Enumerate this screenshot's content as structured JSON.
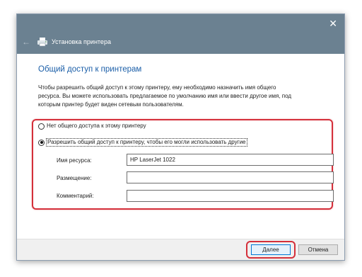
{
  "window": {
    "title": "Установка принтера",
    "close_glyph": "✕",
    "back_glyph": "←"
  },
  "page": {
    "heading": "Общий доступ к принтерам",
    "description": "Чтобы разрешить общий доступ к этому принтеру, ему необходимо назначить имя общего\nресурса. Вы можете использовать предлагаемое по умолчанию имя или ввести другое имя, под\nкоторым принтер будет виден сетевым пользователям."
  },
  "options": {
    "no_share_label": "Нет общего доступа к этому принтеру",
    "share_label": "Разрешить общий доступ к принтеру, чтобы его могли использовать другие",
    "selected": "share"
  },
  "fields": {
    "share_name_label": "Имя ресурса:",
    "share_name_value": "HP LaserJet 1022",
    "location_label": "Размещение:",
    "location_value": "",
    "comment_label": "Комментарий:",
    "comment_value": ""
  },
  "buttons": {
    "next_label": "Далее",
    "cancel_label": "Отмена"
  },
  "colors": {
    "titlebar": "#6b8191",
    "heading": "#1a5ea8",
    "highlight": "#d42f3a"
  },
  "icons": {
    "printer": "printer-icon",
    "close": "close-icon",
    "back": "back-arrow-icon"
  }
}
